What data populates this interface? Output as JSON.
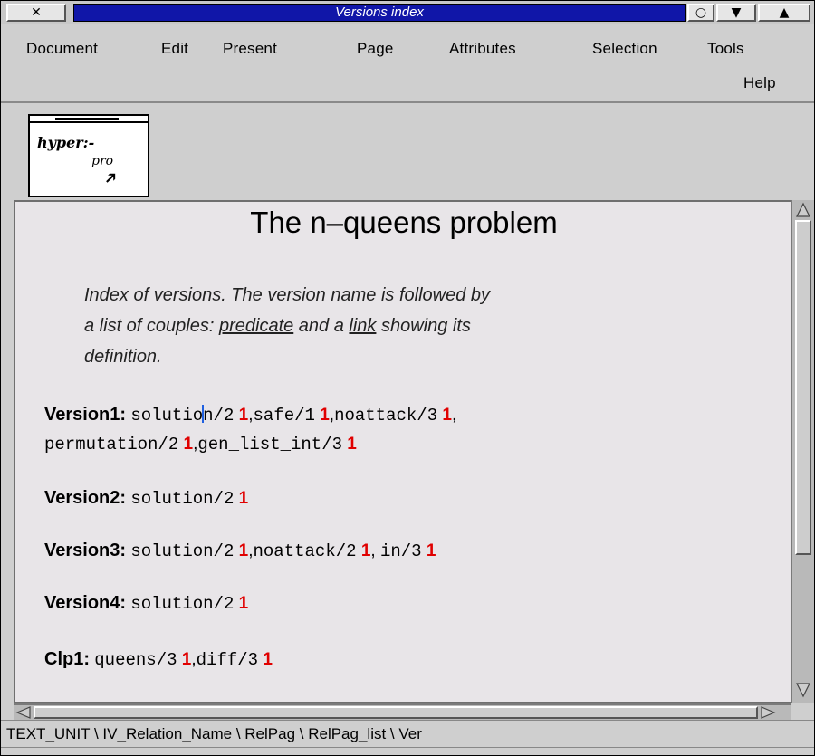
{
  "window": {
    "title": "Versions index",
    "close_glyph": "✕",
    "iconify_glyph": "○",
    "lower_glyph": "▼",
    "raise_glyph": "▲"
  },
  "menu": {
    "items": [
      "Document",
      "Edit",
      "Present",
      "Page",
      "Attributes",
      "Selection",
      "Tools"
    ],
    "help": "Help"
  },
  "logo": {
    "line1": "hyper:-",
    "line2": "pro",
    "arrow_icon": "arrow-pointer-icon"
  },
  "document": {
    "title": "The n–queens problem",
    "intro_1": "Index of versions. The version name is followed by",
    "intro_2a": "a list of couples: ",
    "intro_predicate": "predicate",
    "intro_2b": " and a ",
    "intro_link": "link",
    "intro_2c": " showing its",
    "intro_3": "definition.",
    "ref": "1",
    "versions": [
      {
        "name": "Version1:",
        "lines": [
          [
            "solutio",
            "n/2",
            "safe/1",
            "noattack/3"
          ],
          [
            "permutation/2",
            "gen_list_int/3"
          ]
        ]
      },
      {
        "name": "Version2:",
        "preds": [
          "solution/2"
        ]
      },
      {
        "name": "Version3:",
        "preds": [
          "solution/2",
          "noattack/2",
          "in/3"
        ]
      },
      {
        "name": "Version4:",
        "preds": [
          "solution/2"
        ]
      },
      {
        "name": "Clp1:",
        "preds": [
          "queens/3",
          "diff/3"
        ]
      }
    ]
  },
  "status": {
    "path": "TEXT_UNIT \\ IV_Relation_Name \\ RelPag \\ RelPag_list \\ Ver"
  },
  "colors": {
    "title_active": "#1016a8",
    "reference_link": "#e00000",
    "document_bg": "#e8e5e8",
    "chrome_bg": "#cfcfcf"
  }
}
